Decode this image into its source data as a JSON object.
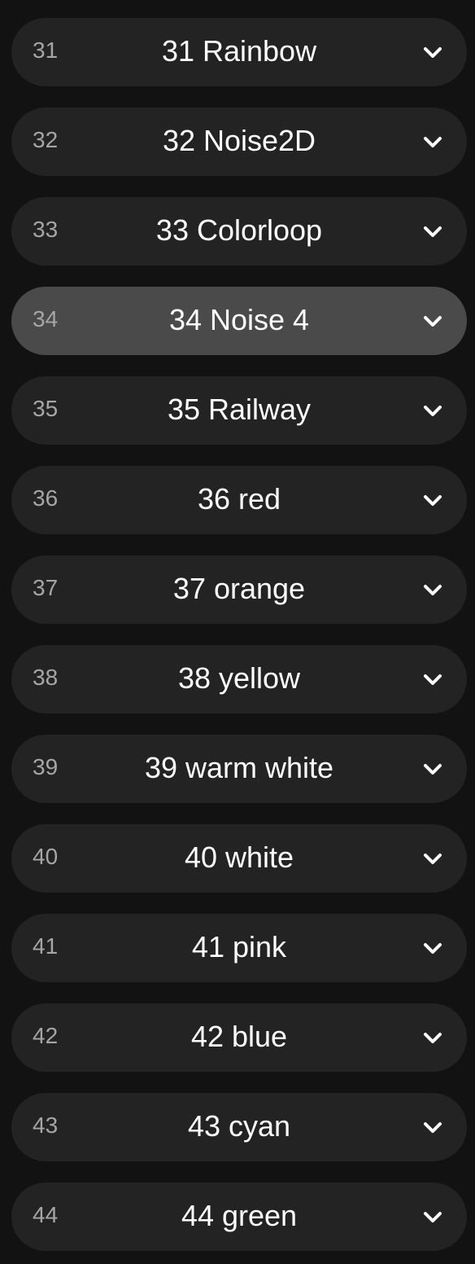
{
  "colors": {
    "background": "#121212",
    "row_bg": "#232323",
    "row_active_bg": "#4a4a4a",
    "number_text": "#a6a6a6",
    "label_text": "#ffffff"
  },
  "list": {
    "items": [
      {
        "number": "31",
        "label": "31 Rainbow",
        "active": false,
        "icon": "chevron-down-icon"
      },
      {
        "number": "32",
        "label": "32 Noise2D",
        "active": false,
        "icon": "chevron-down-icon"
      },
      {
        "number": "33",
        "label": "33 Colorloop",
        "active": false,
        "icon": "chevron-down-icon"
      },
      {
        "number": "34",
        "label": "34 Noise 4",
        "active": true,
        "icon": "chevron-down-icon"
      },
      {
        "number": "35",
        "label": "35 Railway",
        "active": false,
        "icon": "chevron-down-icon"
      },
      {
        "number": "36",
        "label": "36 red",
        "active": false,
        "icon": "chevron-down-icon"
      },
      {
        "number": "37",
        "label": "37 orange",
        "active": false,
        "icon": "chevron-down-icon"
      },
      {
        "number": "38",
        "label": "38 yellow",
        "active": false,
        "icon": "chevron-down-icon"
      },
      {
        "number": "39",
        "label": "39 warm white",
        "active": false,
        "icon": "chevron-down-icon"
      },
      {
        "number": "40",
        "label": "40 white",
        "active": false,
        "icon": "chevron-down-icon"
      },
      {
        "number": "41",
        "label": "41 pink",
        "active": false,
        "icon": "chevron-down-icon"
      },
      {
        "number": "42",
        "label": "42 blue",
        "active": false,
        "icon": "chevron-down-icon"
      },
      {
        "number": "43",
        "label": "43 cyan",
        "active": false,
        "icon": "chevron-down-icon"
      },
      {
        "number": "44",
        "label": "44 green",
        "active": false,
        "icon": "chevron-down-icon"
      }
    ]
  }
}
